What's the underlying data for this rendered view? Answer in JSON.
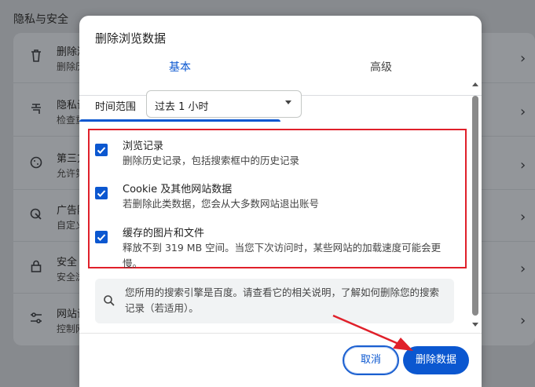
{
  "background": {
    "title": "隐私与安全",
    "rows": [
      {
        "icon": "trash-icon",
        "line1": "删除浏",
        "line2": "删除历"
      },
      {
        "icon": "shield-icon",
        "line1": "隐私设",
        "line2": "检查重"
      },
      {
        "icon": "cookie-icon",
        "line1": "第三方",
        "line2": "允许第"
      },
      {
        "icon": "ad-icon",
        "line1": "广告隐",
        "line2": "自定义"
      },
      {
        "icon": "lock-icon",
        "line1": "安全",
        "line2": "安全浏"
      },
      {
        "icon": "sliders-icon",
        "line1": "网站设",
        "line2": "控制网"
      }
    ]
  },
  "dialog": {
    "title": "删除浏览数据",
    "tabs": [
      {
        "label": "基本",
        "active": true
      },
      {
        "label": "高级",
        "active": false
      }
    ],
    "time_range": {
      "label": "时间范围",
      "selected": "过去 1 小时"
    },
    "options": [
      {
        "title": "浏览记录",
        "desc": "删除历史记录，包括搜索框中的历史记录",
        "checked": true
      },
      {
        "title": "Cookie 及其他网站数据",
        "desc": "若删除此类数据，您会从大多数网站退出账号",
        "checked": true
      },
      {
        "title": "缓存的图片和文件",
        "desc": "释放不到 319 MB 空间。当您下次访问时，某些网站的加载速度可能会更慢。",
        "checked": true
      }
    ],
    "info_text": "您所用的搜索引擎是百度。请查看它的相关说明，了解如何删除您的搜索记录（若适用）。",
    "buttons": {
      "cancel": "取消",
      "delete": "删除数据"
    }
  },
  "colors": {
    "accent": "#0b57d0",
    "highlight_box": "#e0202a",
    "overlay": "#878a8e"
  }
}
